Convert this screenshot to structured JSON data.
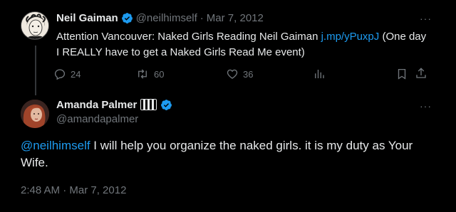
{
  "tweet1": {
    "author_name": "Neil Gaiman",
    "author_handle": "@neilhimself",
    "separator": "·",
    "date": "Mar 7, 2012",
    "more_label": "···",
    "text_before_link": "Attention Vancouver: Naked Girls Reading Neil Gaiman ",
    "link_text": "j.mp/yPuxpJ",
    "text_after_link": " (One day I REALLY have to get a Naked Girls Read Me event)",
    "replies": "24",
    "retweets": "60",
    "likes": "36"
  },
  "tweet2": {
    "author_name": "Amanda Palmer",
    "author_handle": "@amandapalmer",
    "more_label": "···",
    "mention": "@neilhimself",
    "text": " I will help you organize the naked girls. it is my duty as Your Wife.",
    "timestamp": "2:48 AM · Mar 7, 2012"
  },
  "colors": {
    "background": "#000000",
    "text": "#e7e9ea",
    "muted": "#71767b",
    "link": "#1d9bf0",
    "verified": "#1d9bf0"
  },
  "icons": [
    "reply-icon",
    "retweet-icon",
    "like-icon",
    "views-icon",
    "bookmark-icon",
    "share-icon",
    "verified-badge-icon",
    "piano-keys-emoji"
  ]
}
